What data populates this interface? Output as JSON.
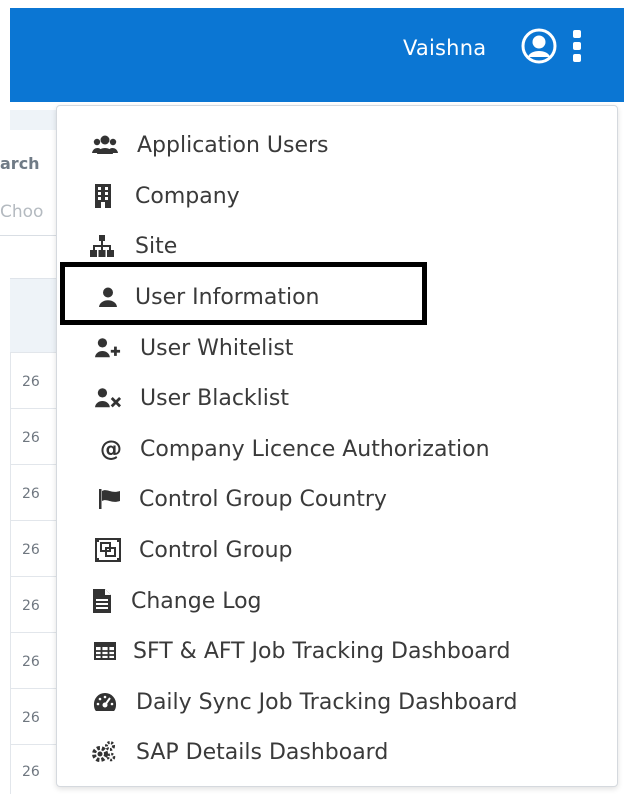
{
  "header": {
    "user_name": "Vaishna",
    "bar_color": "#0b76d3",
    "avatar_icon": "user-circle-icon",
    "more_icon": "kebab-vertical-icon"
  },
  "background": {
    "search_label": "arch",
    "choose_placeholder": "Choo",
    "row_date_prefix": "26"
  },
  "menu": {
    "highlighted_item": "User Information",
    "items": [
      {
        "label": "Application Users",
        "icon": "users-icon"
      },
      {
        "label": "Company",
        "icon": "building-icon"
      },
      {
        "label": "Site",
        "icon": "sitemap-icon"
      },
      {
        "label": "User Information",
        "icon": "user-icon"
      },
      {
        "label": "User Whitelist",
        "icon": "user-plus-icon"
      },
      {
        "label": "User Blacklist",
        "icon": "user-times-icon"
      },
      {
        "label": "Company Licence Authorization",
        "icon": "at-icon"
      },
      {
        "label": "Control Group Country",
        "icon": "flag-icon"
      },
      {
        "label": "Control Group",
        "icon": "object-group-icon"
      },
      {
        "label": "Change Log",
        "icon": "file-text-icon"
      },
      {
        "label": "SFT & AFT Job Tracking Dashboard",
        "icon": "table-icon"
      },
      {
        "label": "Daily Sync Job Tracking Dashboard",
        "icon": "tachometer-icon"
      },
      {
        "label": "SAP Details Dashboard",
        "icon": "cogs-icon"
      }
    ]
  }
}
